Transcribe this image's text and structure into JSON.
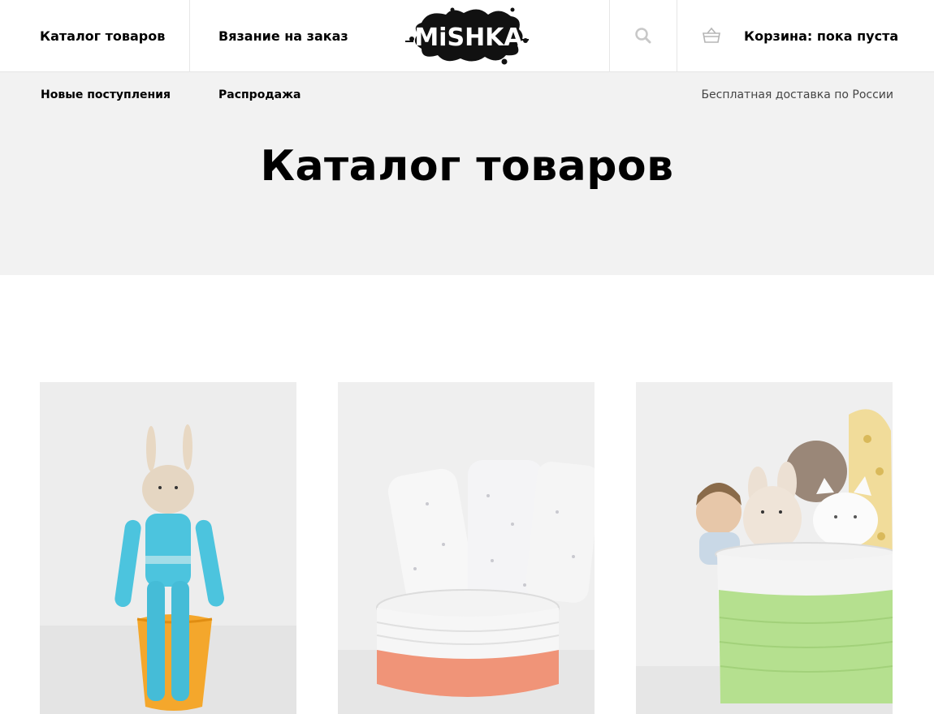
{
  "header": {
    "nav_catalog": "Каталог товаров",
    "nav_knitting": "Вязание на заказ",
    "logo_text": "MiSHKA",
    "cart_label": "Корзина: пока пуста"
  },
  "subnav": {
    "new_arrivals": "Новые поступления",
    "sale": "Распродажа",
    "shipping_note": "Бесплатная доставка по России"
  },
  "page": {
    "title": "Каталог товаров"
  },
  "products": [
    {
      "image": "crochet-bunny-toy"
    },
    {
      "image": "swaddle-blankets-in-basket"
    },
    {
      "image": "toys-in-green-basket"
    }
  ],
  "colors": {
    "hero_bg": "#f2f2f2",
    "text": "#000000",
    "muted": "#444444",
    "border": "#e6e6e6"
  }
}
